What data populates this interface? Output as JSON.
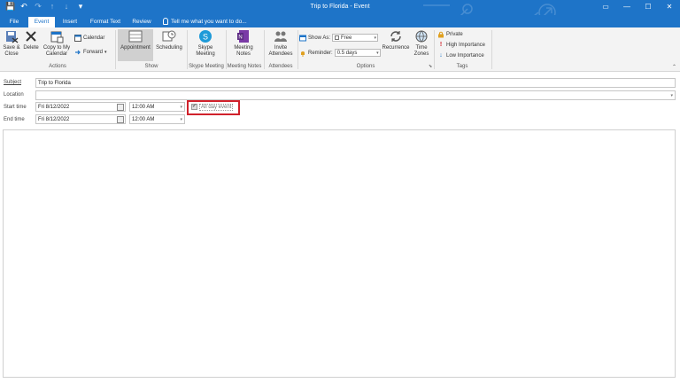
{
  "window": {
    "title": "Trip to Florida  -  Event"
  },
  "qat": {
    "save_glyph": "💾",
    "undo_glyph": "↶",
    "redo_glyph": "↷",
    "up_glyph": "↑",
    "down_glyph": "↓",
    "more_glyph": "▾"
  },
  "winctl": {
    "restore_glyph": "▭",
    "min_glyph": "—",
    "max_glyph": "☐",
    "close_glyph": "✕"
  },
  "tabs": [
    {
      "label": "File"
    },
    {
      "label": "Event"
    },
    {
      "label": "Insert"
    },
    {
      "label": "Format Text"
    },
    {
      "label": "Review"
    }
  ],
  "tell_me": "Tell me what you want to do...",
  "ribbon": {
    "actions": {
      "save_close": "Save & Close",
      "delete": "Delete",
      "copy_calendar": "Copy to My Calendar",
      "calendar": "Calendar",
      "forward": "Forward",
      "group_label": "Actions"
    },
    "show": {
      "appointment": "Appointment",
      "scheduling": "Scheduling",
      "group_label": "Show"
    },
    "skype": {
      "label": "Skype Meeting",
      "group_label": "Skype Meeting"
    },
    "meeting_notes": {
      "label": "Meeting Notes",
      "group_label": "Meeting Notes"
    },
    "attendees": {
      "label": "Invite Attendees",
      "group_label": "Attendees"
    },
    "options": {
      "show_as_label": "Show As:",
      "show_as_value": "Free",
      "reminder_label": "Reminder:",
      "reminder_value": "0.5 days",
      "recurrence": "Recurrence",
      "time_zones": "Time Zones",
      "group_label": "Options"
    },
    "tags": {
      "private": "Private",
      "high": "High Importance",
      "low": "Low Importance",
      "group_label": "Tags"
    }
  },
  "form": {
    "subject_label": "Subject",
    "subject_value": "Trip to Florida",
    "location_label": "Location",
    "location_value": "",
    "start_label": "Start time",
    "start_date": "Fri 8/12/2022",
    "start_time": "12:00 AM",
    "end_label": "End time",
    "end_date": "Fri 8/12/2022",
    "end_time": "12:00 AM",
    "all_day_label": "All day event",
    "all_day_checked": true
  },
  "colors": {
    "accent": "#1e74c8",
    "highlight": "#d0212b"
  },
  "icons": [
    "save-icon",
    "undo-icon",
    "redo-icon",
    "delete-icon",
    "calendar-icon",
    "forward-icon",
    "appointment-icon",
    "scheduling-icon",
    "skype-icon",
    "onenote-icon",
    "attendees-icon",
    "recurrence-icon",
    "timezone-icon",
    "lock-icon",
    "high-importance-icon",
    "low-importance-icon",
    "lightbulb-icon"
  ]
}
